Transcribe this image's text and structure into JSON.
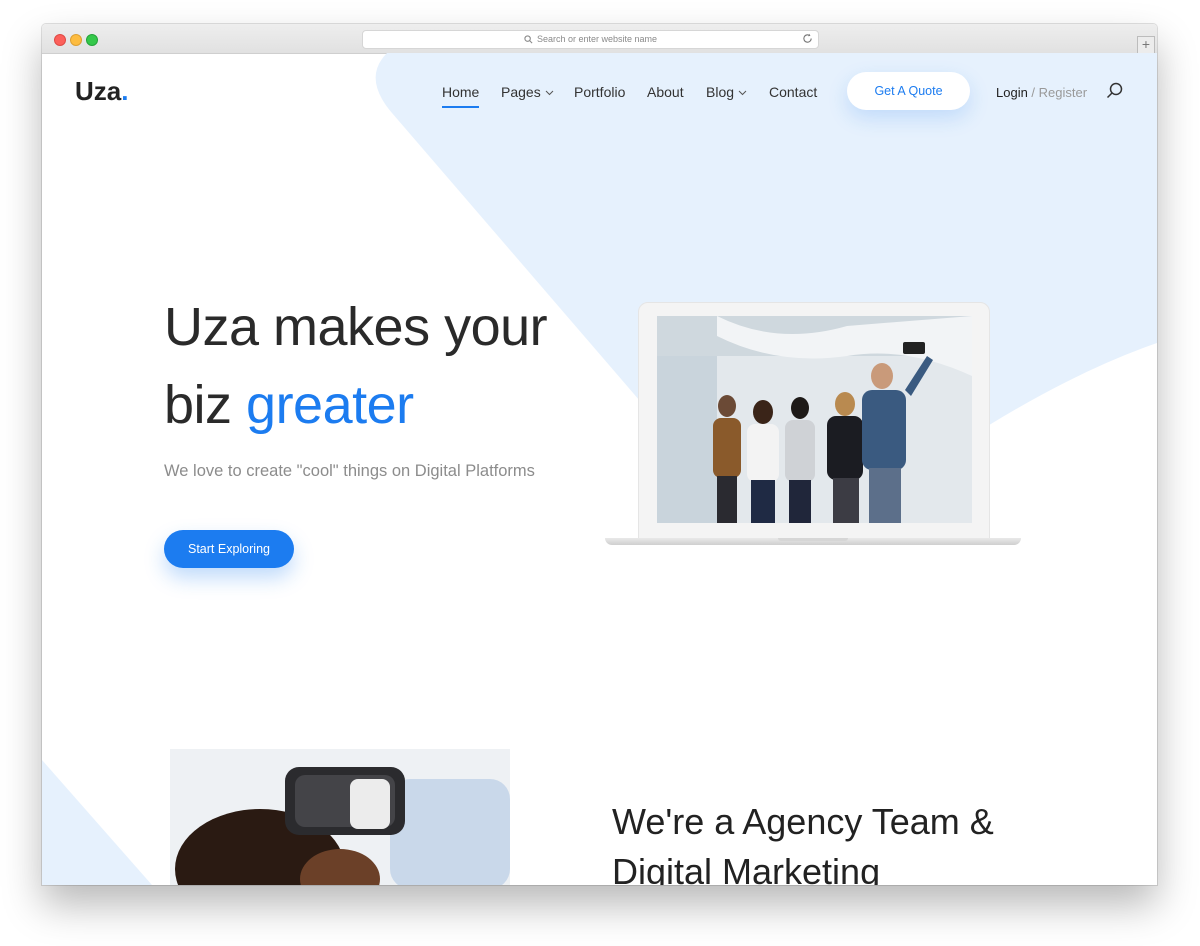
{
  "browser": {
    "address_placeholder": "Search or enter website name",
    "new_tab_glyph": "+"
  },
  "header": {
    "logo_text": "Uza",
    "logo_dot": ".",
    "nav": [
      {
        "label": "Home",
        "active": true
      },
      {
        "label": "Pages",
        "dropdown": true
      },
      {
        "label": "Portfolio"
      },
      {
        "label": "About"
      },
      {
        "label": "Blog",
        "dropdown": true
      },
      {
        "label": "Contact"
      }
    ],
    "quote_button": "Get A Quote",
    "login": "Login",
    "separator": " / ",
    "register": "Register",
    "search_icon": "search-icon"
  },
  "hero": {
    "title_line1": "Uza makes your",
    "title_line2_prefix": "biz ",
    "title_accent": "greater",
    "subtitle": "We love to create \"cool\" things on Digital Platforms",
    "cta": "Start Exploring"
  },
  "about": {
    "title_line1": "We're a Agency Team &",
    "title_line2": "Digital Marketing"
  },
  "colors": {
    "accent": "#1c7cf0",
    "light_blue_bg": "#e6f1fd",
    "text_dark": "#222222",
    "text_muted": "#8c8c8c"
  }
}
